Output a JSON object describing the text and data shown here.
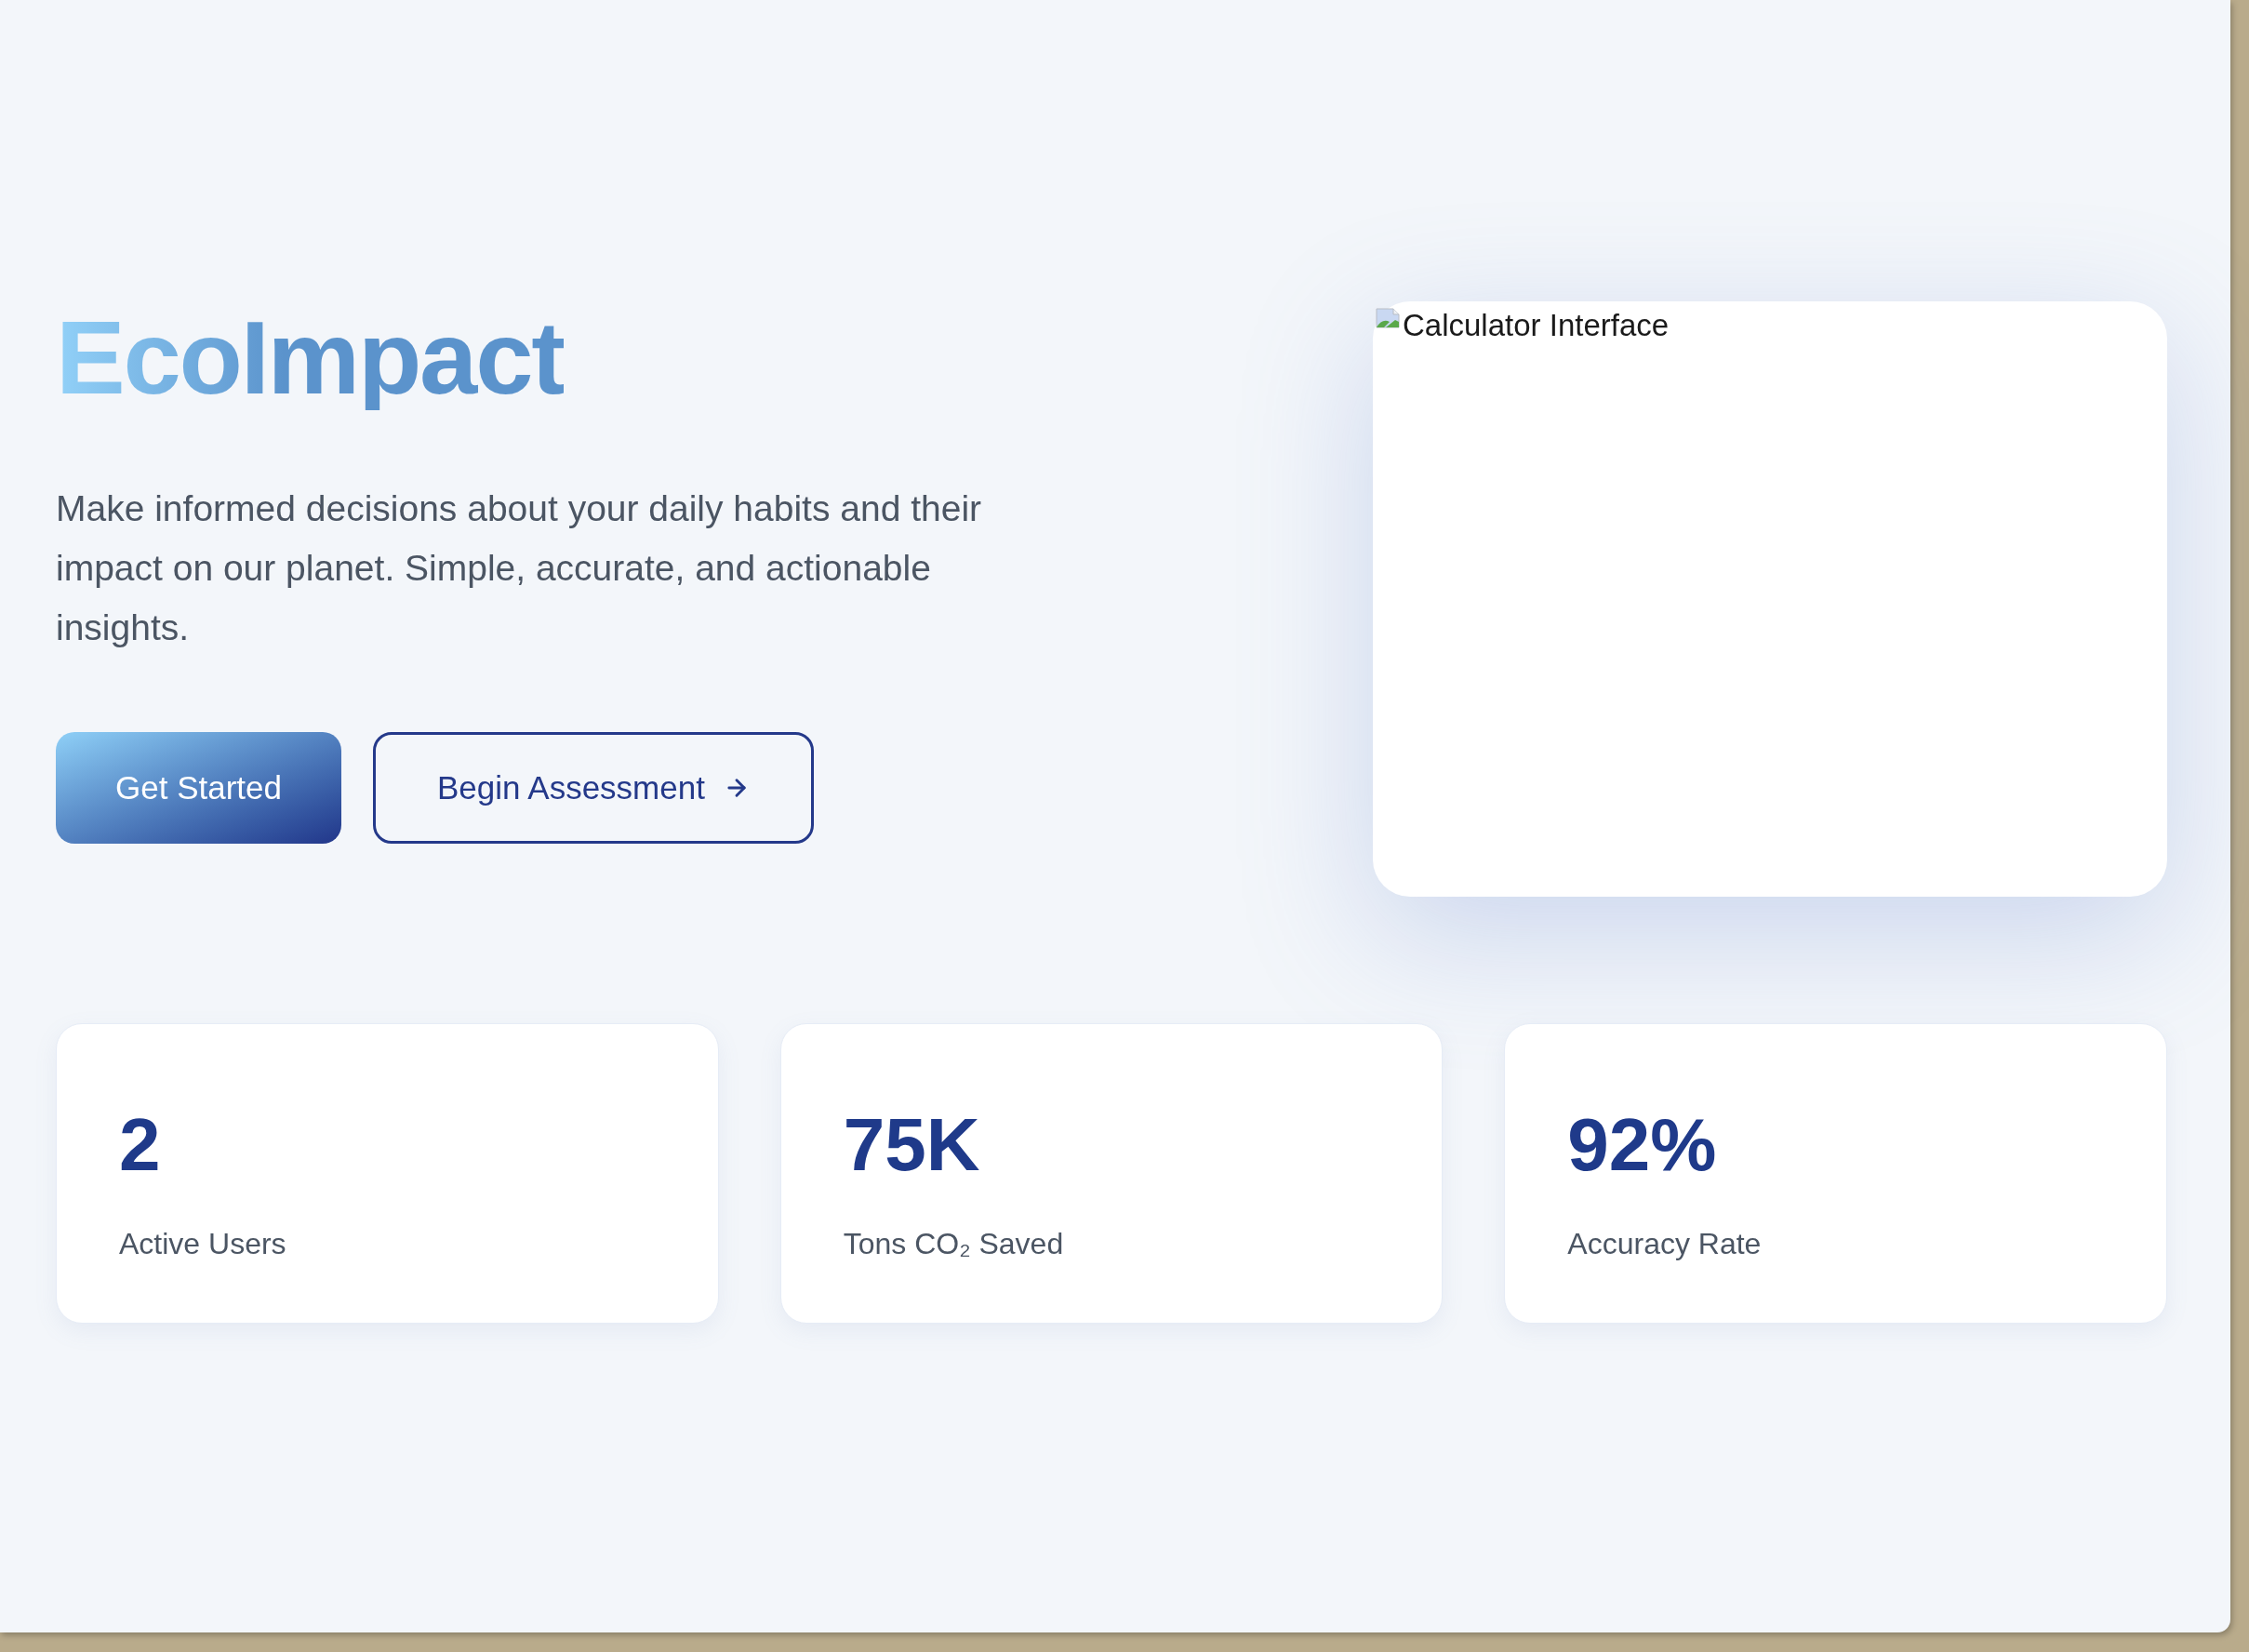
{
  "hero": {
    "title": "EcoImpact",
    "description": "Make informed decisions about your daily habits and their impact on our planet. Simple, accurate, and actionable insights.",
    "buttons": [
      {
        "label": "Get Started",
        "kind": "primary",
        "trailing_icon": false
      },
      {
        "label": "Begin Assessment",
        "kind": "outline",
        "trailing_icon": true
      }
    ]
  },
  "preview": {
    "alt_text": "Calculator Interface",
    "broken_image": true
  },
  "stats": [
    {
      "value": "2",
      "label": "Active Users"
    },
    {
      "value": "75K",
      "label": "Tons CO₂ Saved"
    },
    {
      "value": "92%",
      "label": "Accuracy Rate"
    }
  ]
}
